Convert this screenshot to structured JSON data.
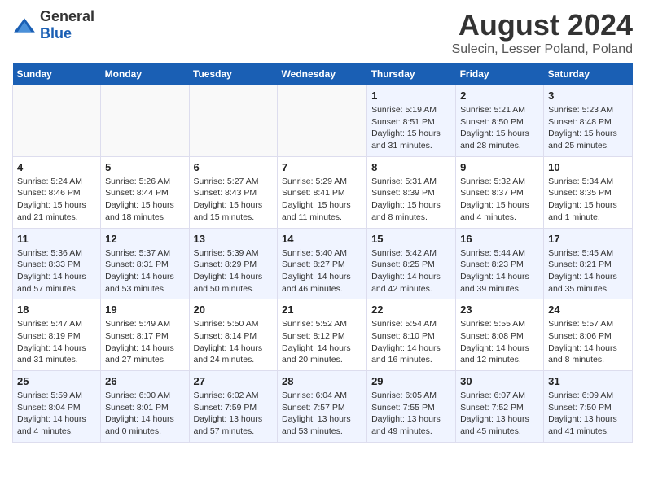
{
  "header": {
    "logo_general": "General",
    "logo_blue": "Blue",
    "main_title": "August 2024",
    "subtitle": "Sulecin, Lesser Poland, Poland"
  },
  "weekdays": [
    "Sunday",
    "Monday",
    "Tuesday",
    "Wednesday",
    "Thursday",
    "Friday",
    "Saturday"
  ],
  "weeks": [
    [
      {
        "day": "",
        "info": ""
      },
      {
        "day": "",
        "info": ""
      },
      {
        "day": "",
        "info": ""
      },
      {
        "day": "",
        "info": ""
      },
      {
        "day": "1",
        "info": "Sunrise: 5:19 AM\nSunset: 8:51 PM\nDaylight: 15 hours\nand 31 minutes."
      },
      {
        "day": "2",
        "info": "Sunrise: 5:21 AM\nSunset: 8:50 PM\nDaylight: 15 hours\nand 28 minutes."
      },
      {
        "day": "3",
        "info": "Sunrise: 5:23 AM\nSunset: 8:48 PM\nDaylight: 15 hours\nand 25 minutes."
      }
    ],
    [
      {
        "day": "4",
        "info": "Sunrise: 5:24 AM\nSunset: 8:46 PM\nDaylight: 15 hours\nand 21 minutes."
      },
      {
        "day": "5",
        "info": "Sunrise: 5:26 AM\nSunset: 8:44 PM\nDaylight: 15 hours\nand 18 minutes."
      },
      {
        "day": "6",
        "info": "Sunrise: 5:27 AM\nSunset: 8:43 PM\nDaylight: 15 hours\nand 15 minutes."
      },
      {
        "day": "7",
        "info": "Sunrise: 5:29 AM\nSunset: 8:41 PM\nDaylight: 15 hours\nand 11 minutes."
      },
      {
        "day": "8",
        "info": "Sunrise: 5:31 AM\nSunset: 8:39 PM\nDaylight: 15 hours\nand 8 minutes."
      },
      {
        "day": "9",
        "info": "Sunrise: 5:32 AM\nSunset: 8:37 PM\nDaylight: 15 hours\nand 4 minutes."
      },
      {
        "day": "10",
        "info": "Sunrise: 5:34 AM\nSunset: 8:35 PM\nDaylight: 15 hours\nand 1 minute."
      }
    ],
    [
      {
        "day": "11",
        "info": "Sunrise: 5:36 AM\nSunset: 8:33 PM\nDaylight: 14 hours\nand 57 minutes."
      },
      {
        "day": "12",
        "info": "Sunrise: 5:37 AM\nSunset: 8:31 PM\nDaylight: 14 hours\nand 53 minutes."
      },
      {
        "day": "13",
        "info": "Sunrise: 5:39 AM\nSunset: 8:29 PM\nDaylight: 14 hours\nand 50 minutes."
      },
      {
        "day": "14",
        "info": "Sunrise: 5:40 AM\nSunset: 8:27 PM\nDaylight: 14 hours\nand 46 minutes."
      },
      {
        "day": "15",
        "info": "Sunrise: 5:42 AM\nSunset: 8:25 PM\nDaylight: 14 hours\nand 42 minutes."
      },
      {
        "day": "16",
        "info": "Sunrise: 5:44 AM\nSunset: 8:23 PM\nDaylight: 14 hours\nand 39 minutes."
      },
      {
        "day": "17",
        "info": "Sunrise: 5:45 AM\nSunset: 8:21 PM\nDaylight: 14 hours\nand 35 minutes."
      }
    ],
    [
      {
        "day": "18",
        "info": "Sunrise: 5:47 AM\nSunset: 8:19 PM\nDaylight: 14 hours\nand 31 minutes."
      },
      {
        "day": "19",
        "info": "Sunrise: 5:49 AM\nSunset: 8:17 PM\nDaylight: 14 hours\nand 27 minutes."
      },
      {
        "day": "20",
        "info": "Sunrise: 5:50 AM\nSunset: 8:14 PM\nDaylight: 14 hours\nand 24 minutes."
      },
      {
        "day": "21",
        "info": "Sunrise: 5:52 AM\nSunset: 8:12 PM\nDaylight: 14 hours\nand 20 minutes."
      },
      {
        "day": "22",
        "info": "Sunrise: 5:54 AM\nSunset: 8:10 PM\nDaylight: 14 hours\nand 16 minutes."
      },
      {
        "day": "23",
        "info": "Sunrise: 5:55 AM\nSunset: 8:08 PM\nDaylight: 14 hours\nand 12 minutes."
      },
      {
        "day": "24",
        "info": "Sunrise: 5:57 AM\nSunset: 8:06 PM\nDaylight: 14 hours\nand 8 minutes."
      }
    ],
    [
      {
        "day": "25",
        "info": "Sunrise: 5:59 AM\nSunset: 8:04 PM\nDaylight: 14 hours\nand 4 minutes."
      },
      {
        "day": "26",
        "info": "Sunrise: 6:00 AM\nSunset: 8:01 PM\nDaylight: 14 hours\nand 0 minutes."
      },
      {
        "day": "27",
        "info": "Sunrise: 6:02 AM\nSunset: 7:59 PM\nDaylight: 13 hours\nand 57 minutes."
      },
      {
        "day": "28",
        "info": "Sunrise: 6:04 AM\nSunset: 7:57 PM\nDaylight: 13 hours\nand 53 minutes."
      },
      {
        "day": "29",
        "info": "Sunrise: 6:05 AM\nSunset: 7:55 PM\nDaylight: 13 hours\nand 49 minutes."
      },
      {
        "day": "30",
        "info": "Sunrise: 6:07 AM\nSunset: 7:52 PM\nDaylight: 13 hours\nand 45 minutes."
      },
      {
        "day": "31",
        "info": "Sunrise: 6:09 AM\nSunset: 7:50 PM\nDaylight: 13 hours\nand 41 minutes."
      }
    ]
  ]
}
